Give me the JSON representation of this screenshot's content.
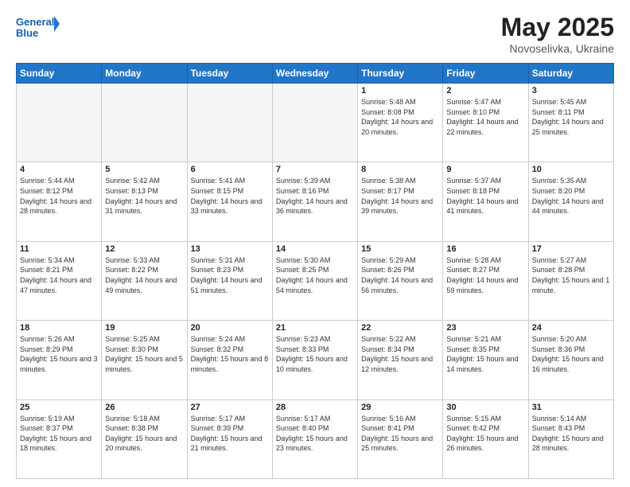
{
  "header": {
    "logo_text_general": "General",
    "logo_text_blue": "Blue",
    "month_title": "May 2025",
    "location": "Novoselivka, Ukraine"
  },
  "calendar": {
    "days_of_week": [
      "Sunday",
      "Monday",
      "Tuesday",
      "Wednesday",
      "Thursday",
      "Friday",
      "Saturday"
    ],
    "weeks": [
      [
        {
          "day": "",
          "empty": true
        },
        {
          "day": "",
          "empty": true
        },
        {
          "day": "",
          "empty": true
        },
        {
          "day": "",
          "empty": true
        },
        {
          "day": "1",
          "sunrise": "5:48 AM",
          "sunset": "8:08 PM",
          "daylight": "14 hours and 20 minutes."
        },
        {
          "day": "2",
          "sunrise": "5:47 AM",
          "sunset": "8:10 PM",
          "daylight": "14 hours and 22 minutes."
        },
        {
          "day": "3",
          "sunrise": "5:45 AM",
          "sunset": "8:11 PM",
          "daylight": "14 hours and 25 minutes."
        }
      ],
      [
        {
          "day": "4",
          "sunrise": "5:44 AM",
          "sunset": "8:12 PM",
          "daylight": "14 hours and 28 minutes."
        },
        {
          "day": "5",
          "sunrise": "5:42 AM",
          "sunset": "8:13 PM",
          "daylight": "14 hours and 31 minutes."
        },
        {
          "day": "6",
          "sunrise": "5:41 AM",
          "sunset": "8:15 PM",
          "daylight": "14 hours and 33 minutes."
        },
        {
          "day": "7",
          "sunrise": "5:39 AM",
          "sunset": "8:16 PM",
          "daylight": "14 hours and 36 minutes."
        },
        {
          "day": "8",
          "sunrise": "5:38 AM",
          "sunset": "8:17 PM",
          "daylight": "14 hours and 39 minutes."
        },
        {
          "day": "9",
          "sunrise": "5:37 AM",
          "sunset": "8:18 PM",
          "daylight": "14 hours and 41 minutes."
        },
        {
          "day": "10",
          "sunrise": "5:35 AM",
          "sunset": "8:20 PM",
          "daylight": "14 hours and 44 minutes."
        }
      ],
      [
        {
          "day": "11",
          "sunrise": "5:34 AM",
          "sunset": "8:21 PM",
          "daylight": "14 hours and 47 minutes."
        },
        {
          "day": "12",
          "sunrise": "5:33 AM",
          "sunset": "8:22 PM",
          "daylight": "14 hours and 49 minutes."
        },
        {
          "day": "13",
          "sunrise": "5:31 AM",
          "sunset": "8:23 PM",
          "daylight": "14 hours and 51 minutes."
        },
        {
          "day": "14",
          "sunrise": "5:30 AM",
          "sunset": "8:25 PM",
          "daylight": "14 hours and 54 minutes."
        },
        {
          "day": "15",
          "sunrise": "5:29 AM",
          "sunset": "8:26 PM",
          "daylight": "14 hours and 56 minutes."
        },
        {
          "day": "16",
          "sunrise": "5:28 AM",
          "sunset": "8:27 PM",
          "daylight": "14 hours and 59 minutes."
        },
        {
          "day": "17",
          "sunrise": "5:27 AM",
          "sunset": "8:28 PM",
          "daylight": "15 hours and 1 minute."
        }
      ],
      [
        {
          "day": "18",
          "sunrise": "5:26 AM",
          "sunset": "8:29 PM",
          "daylight": "15 hours and 3 minutes."
        },
        {
          "day": "19",
          "sunrise": "5:25 AM",
          "sunset": "8:30 PM",
          "daylight": "15 hours and 5 minutes."
        },
        {
          "day": "20",
          "sunrise": "5:24 AM",
          "sunset": "8:32 PM",
          "daylight": "15 hours and 8 minutes."
        },
        {
          "day": "21",
          "sunrise": "5:23 AM",
          "sunset": "8:33 PM",
          "daylight": "15 hours and 10 minutes."
        },
        {
          "day": "22",
          "sunrise": "5:22 AM",
          "sunset": "8:34 PM",
          "daylight": "15 hours and 12 minutes."
        },
        {
          "day": "23",
          "sunrise": "5:21 AM",
          "sunset": "8:35 PM",
          "daylight": "15 hours and 14 minutes."
        },
        {
          "day": "24",
          "sunrise": "5:20 AM",
          "sunset": "8:36 PM",
          "daylight": "15 hours and 16 minutes."
        }
      ],
      [
        {
          "day": "25",
          "sunrise": "5:19 AM",
          "sunset": "8:37 PM",
          "daylight": "15 hours and 18 minutes."
        },
        {
          "day": "26",
          "sunrise": "5:18 AM",
          "sunset": "8:38 PM",
          "daylight": "15 hours and 20 minutes."
        },
        {
          "day": "27",
          "sunrise": "5:17 AM",
          "sunset": "8:39 PM",
          "daylight": "15 hours and 21 minutes."
        },
        {
          "day": "28",
          "sunrise": "5:17 AM",
          "sunset": "8:40 PM",
          "daylight": "15 hours and 23 minutes."
        },
        {
          "day": "29",
          "sunrise": "5:16 AM",
          "sunset": "8:41 PM",
          "daylight": "15 hours and 25 minutes."
        },
        {
          "day": "30",
          "sunrise": "5:15 AM",
          "sunset": "8:42 PM",
          "daylight": "15 hours and 26 minutes."
        },
        {
          "day": "31",
          "sunrise": "5:14 AM",
          "sunset": "8:43 PM",
          "daylight": "15 hours and 28 minutes."
        }
      ]
    ]
  },
  "labels": {
    "sunrise": "Sunrise:",
    "sunset": "Sunset:",
    "daylight": "Daylight:"
  }
}
